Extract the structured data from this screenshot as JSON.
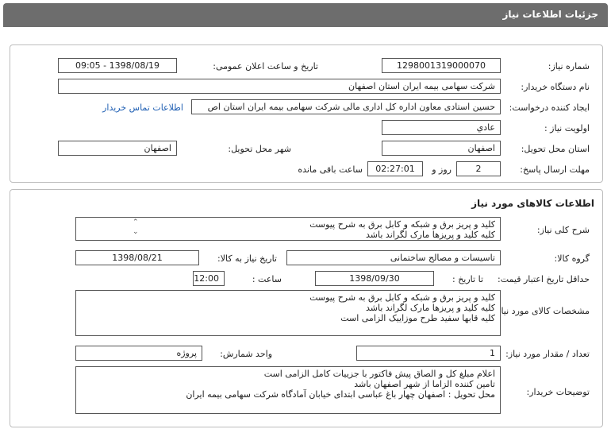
{
  "header": {
    "title": "جزئیات اطلاعات نیاز"
  },
  "need_info": {
    "need_number_label": "شماره نیاز:",
    "need_number": "1298001319000070",
    "announce_label": "تاریخ و ساعت اعلان عمومی:",
    "announce_value": "1398/08/19 - 09:05",
    "buyer_org_label": "نام دستگاه خریدار:",
    "buyer_org": "شرکت سهامی بیمه ایران استان اصفهان",
    "requester_label": "ایجاد کننده درخواست:",
    "requester": "حسین استادی معاون اداره کل اداری مالی شرکت سهامی بیمه ایران استان اص",
    "contact_link": "اطلاعات تماس خریدار",
    "priority_label": "اولویت نیاز :",
    "priority": "عادي",
    "province_label": "استان محل تحویل:",
    "province": "اصفهان",
    "city_label": "شهر محل تحویل:",
    "city": "اصفهان",
    "deadline_label": "مهلت ارسال پاسخ:",
    "days": "2",
    "day_and_label": "روز و",
    "time_left": "02:27:01",
    "time_left_label": "ساعت باقی مانده"
  },
  "goods": {
    "section_title": "اطلاعات کالاهای مورد نیاز",
    "general_desc_label": "شرح کلی نیاز:",
    "general_desc_line1": "کلید و پریز برق و شبکه و کابل برق به شرح پیوست",
    "general_desc_line2": "کلیه کلید و پریزها  مارک لگراند باشد",
    "group_label": "گروه کالا:",
    "group": "تاسیسات و مصالح ساختمانی",
    "need_date_label": "تاریخ نیاز به کالا:",
    "need_date": "1398/08/21",
    "validity_label": "حداقل تاریخ اعتبار قیمت:",
    "until_date_label": "تا تاریخ :",
    "until_date": "1398/09/30",
    "hour_label": "ساعت :",
    "hour": "12:00",
    "spec_label": "مشخصات کالای مورد نیاز:",
    "spec_line1": "کلید و پریز برق و شبکه و کابل برق به شرح پیوست",
    "spec_line2": "کلیه کلید و پریزها  مارک لگراند باشد",
    "spec_line3": "کلیه قابها  سفید طرح موزاییک الزامی است",
    "qty_label": "تعداد / مقدار مورد نیاز:",
    "qty": "1",
    "unit_label": "واحد شمارش:",
    "unit": "پروژه",
    "buyer_notes_label": "توضیحات خریدار:",
    "notes_line1": "اعلام مبلغ کل و الصاق پیش فاکتور با جزییات کامل الزامی است",
    "notes_line2": "تامین کننده الزاما از شهر اصفهان باشد",
    "notes_line3": "محل تحویل : اصفهان چهار باغ عباسی ابتدای خیابان آمادگاه شرکت سهامی بیمه ایران"
  }
}
